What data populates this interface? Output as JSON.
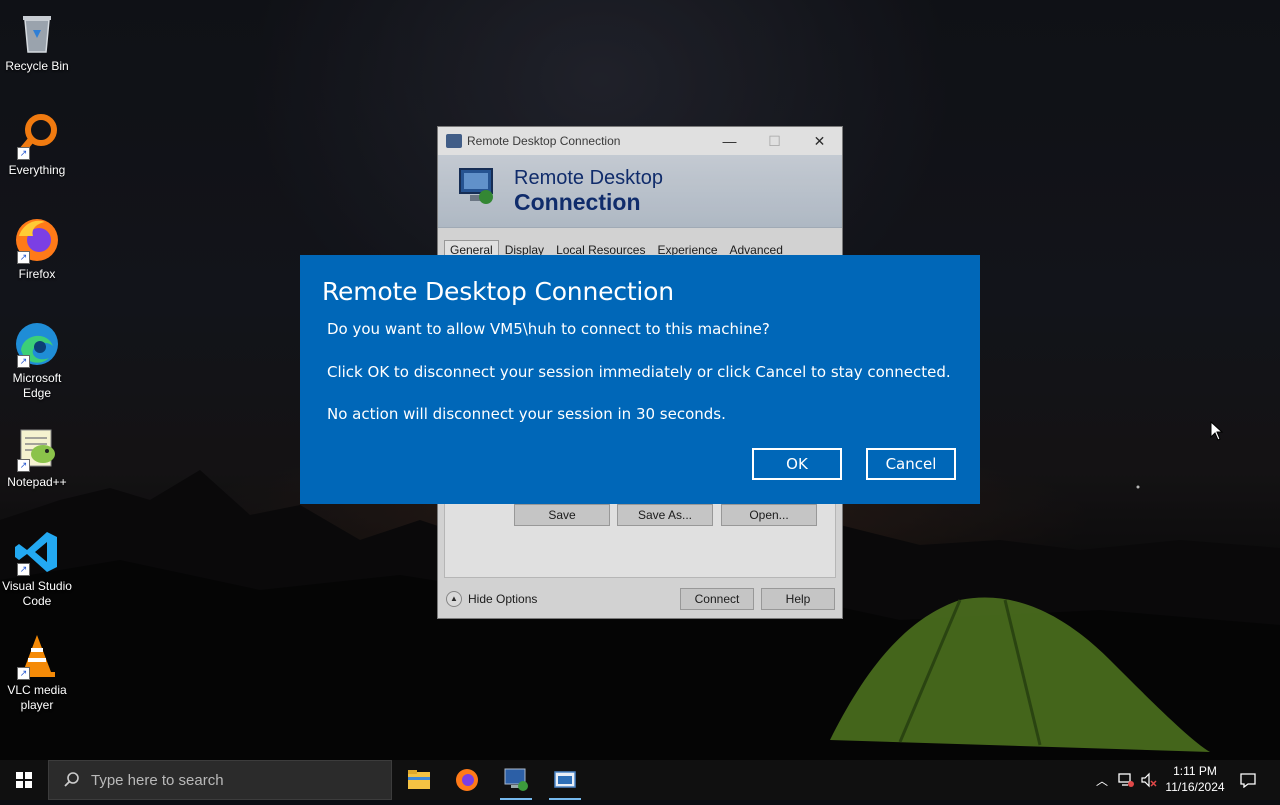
{
  "desktop": {
    "icons": [
      {
        "label": "Recycle Bin",
        "icon": "recycle-bin-icon"
      },
      {
        "label": "Everything",
        "icon": "everything-search-icon"
      },
      {
        "label": "Firefox",
        "icon": "firefox-icon"
      },
      {
        "label": "Microsoft Edge",
        "icon": "edge-icon"
      },
      {
        "label": "Notepad++",
        "icon": "notepadpp-icon"
      },
      {
        "label": "Visual Studio Code",
        "icon": "vscode-icon"
      },
      {
        "label": "VLC media player",
        "icon": "vlc-icon"
      }
    ]
  },
  "rdc_window": {
    "title": "Remote Desktop Connection",
    "banner_line1": "Remote Desktop",
    "banner_line2": "Connection",
    "tabs": [
      "General",
      "Display",
      "Local Resources",
      "Experience",
      "Advanced"
    ],
    "active_tab": "General",
    "save_label": "Save",
    "save_as_label": "Save As...",
    "open_label": "Open...",
    "hide_options_label": "Hide Options",
    "connect_label": "Connect",
    "help_label": "Help"
  },
  "prompt": {
    "title": "Remote Desktop Connection",
    "question": "Do you want to allow VM5\\huh to connect to this machine?",
    "instruction": "Click OK to disconnect your session immediately or click Cancel to stay connected.",
    "timeout_notice": "No action will disconnect your session in 30 seconds.",
    "ok_label": "OK",
    "cancel_label": "Cancel",
    "background_color": "#0067b8"
  },
  "taskbar": {
    "search_placeholder": "Type here to search",
    "pinned_apps": [
      "file-explorer-icon",
      "firefox-icon",
      "remote-desktop-icon",
      "window-app-icon"
    ],
    "clock_time": "1:11 PM",
    "clock_date": "11/16/2024"
  }
}
